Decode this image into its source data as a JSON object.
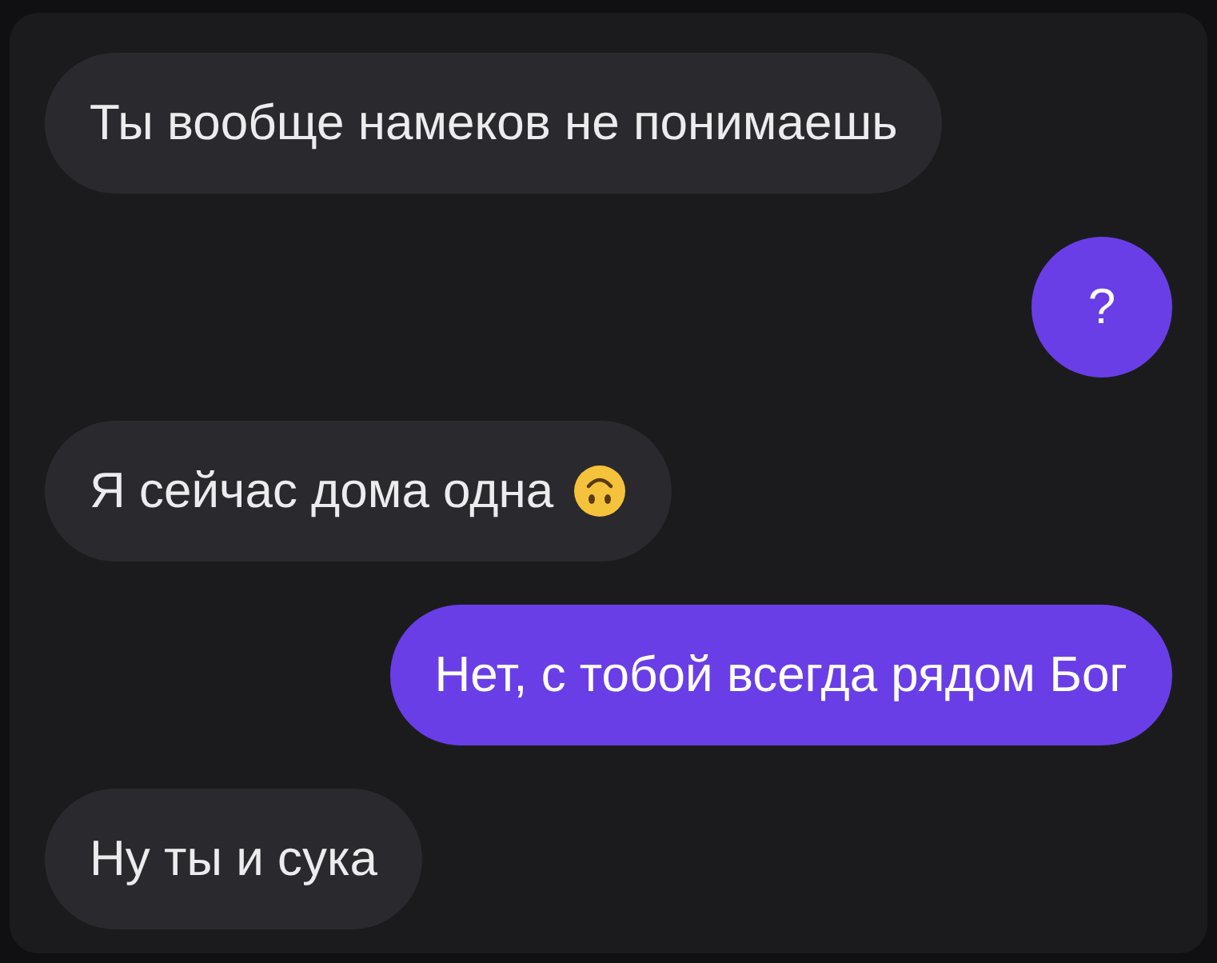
{
  "messages": [
    {
      "kind": "incoming",
      "text": "Ты вообще намеков не понимаешь",
      "emoji": false
    },
    {
      "kind": "outgoing",
      "text": "?",
      "emoji": false
    },
    {
      "kind": "incoming",
      "text": "Я сейчас дома одна",
      "emoji": true
    },
    {
      "kind": "outgoing",
      "text": "Нет, с тобой всегда рядом Бог",
      "emoji": false
    },
    {
      "kind": "incoming",
      "text": "Ну ты и сука",
      "emoji": false
    }
  ]
}
